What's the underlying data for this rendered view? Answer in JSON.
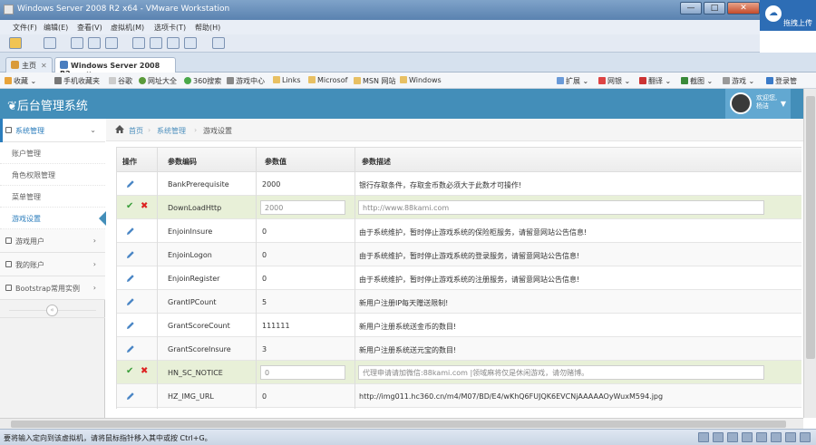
{
  "window": {
    "title": "Windows Server 2008 R2 x64 - VMware Workstation",
    "buttons": [
      "—",
      "□",
      "✕"
    ],
    "cloud_tip": "拖拽上传"
  },
  "vm_menu": [
    "文件(F)",
    "编辑(E)",
    "查看(V)",
    "虚拟机(M)",
    "选项卡(T)",
    "帮助(H)"
  ],
  "browser": {
    "tabs": [
      {
        "label": "主页",
        "active": false
      },
      {
        "label": "Windows Server 2008 R2 ...",
        "active": true
      }
    ],
    "bookmarks": [
      {
        "label": "收藏",
        "icon": "star-icon",
        "arrow": "⌄"
      },
      {
        "label": "手机收藏夹",
        "icon": "phone-icon"
      },
      {
        "label": "谷歌",
        "icon": "page-icon"
      },
      {
        "label": "网址大全",
        "icon": "globe-icon"
      },
      {
        "label": "360搜索",
        "icon": "search-icon"
      },
      {
        "label": "游戏中心",
        "icon": "game-icon"
      },
      {
        "label": "Links",
        "icon": "folder-icon"
      },
      {
        "label": "Microsof",
        "icon": "folder-icon"
      },
      {
        "label": "MSN 网站",
        "icon": "folder-icon"
      },
      {
        "label": "Windows",
        "icon": "folder-icon"
      }
    ],
    "right_tools": [
      {
        "label": "扩展",
        "arrow": "⌄"
      },
      {
        "label": "网银",
        "arrow": "⌄"
      },
      {
        "label": "翻译",
        "arrow": "⌄"
      },
      {
        "label": "截图",
        "arrow": "⌄"
      },
      {
        "label": "游戏",
        "arrow": "⌄"
      },
      {
        "label": "登录管",
        "arrow": ""
      }
    ]
  },
  "app": {
    "brand": "后台管理系统",
    "user_greeting_line1": "欢迎您,",
    "user_greeting_line2": "杨洁"
  },
  "sidebar": {
    "groups": [
      {
        "label": "系统管理",
        "open": true,
        "chev": "⌄"
      },
      {
        "label": "游戏用户",
        "open": false,
        "chev": "›"
      },
      {
        "label": "我的账户",
        "open": false,
        "chev": "›"
      },
      {
        "label": "Bootstrap常用实例",
        "open": false,
        "chev": "›"
      }
    ],
    "sub_items": [
      {
        "label": "账户管理"
      },
      {
        "label": "角色权限管理"
      },
      {
        "label": "菜单管理"
      },
      {
        "label": "游戏设置",
        "active": true
      }
    ],
    "collapse_glyph": "«"
  },
  "breadcrumb": {
    "sep": "›",
    "home": "首页",
    "section": "系统管理",
    "current": "游戏设置"
  },
  "table": {
    "headers": [
      "操作",
      "参数编码",
      "参数值",
      "参数描述"
    ],
    "action_icons": {
      "edit": "✎",
      "save": "✔",
      "cancel": "✖",
      "settings": "⚙"
    },
    "rows": [
      {
        "code": "BankPrerequisite",
        "value": "2000",
        "desc": "银行存取条件，存取金币数必须大于此数才可操作!",
        "editing": false
      },
      {
        "code": "DownLoadHttp",
        "value": "2000",
        "desc": "http://www.88kami.com",
        "editing": true
      },
      {
        "code": "EnjoinInsure",
        "value": "0",
        "desc": "由于系统维护，暂时停止游戏系统的保险柜服务，请留意网站公告信息!",
        "editing": false
      },
      {
        "code": "EnjoinLogon",
        "value": "0",
        "desc": "由于系统维护，暂时停止游戏系统的登录服务，请留意网站公告信息!",
        "editing": false
      },
      {
        "code": "EnjoinRegister",
        "value": "0",
        "desc": "由于系统维护，暂时停止游戏系统的注册服务，请留意网站公告信息!",
        "editing": false
      },
      {
        "code": "GrantIPCount",
        "value": "5",
        "desc": "新用户注册IP每天赠送限制!",
        "editing": false
      },
      {
        "code": "GrantScoreCount",
        "value": "111111",
        "desc": "新用户注册系统送金币的数目!",
        "editing": false
      },
      {
        "code": "GrantScoreInsure",
        "value": "3",
        "desc": "新用户注册系统送元宝的数目!",
        "editing": false
      },
      {
        "code": "HN_SC_NOTICE",
        "value": "0",
        "desc": "代理申请请加微信:88kami.com |领域麻将仅是休闲游戏，请勿赌博。",
        "editing": true
      },
      {
        "code": "HZ_IMG_URL",
        "value": "0",
        "desc": "http://img011.hc360.cn/m4/M07/BD/E4/wKhQ6FUJQK6EVCNjAAAAAOyWuxM594.jpg",
        "editing": false
      }
    ]
  },
  "status": {
    "text": "要将输入定向到该虚拟机，请将鼠标指针移入其中或按 Ctrl+G。"
  },
  "colors": {
    "header": "#438eb9",
    "accent": "#2b7dbc",
    "editing_row": "#e8f0d8",
    "settings_btn": "#f0b460"
  }
}
